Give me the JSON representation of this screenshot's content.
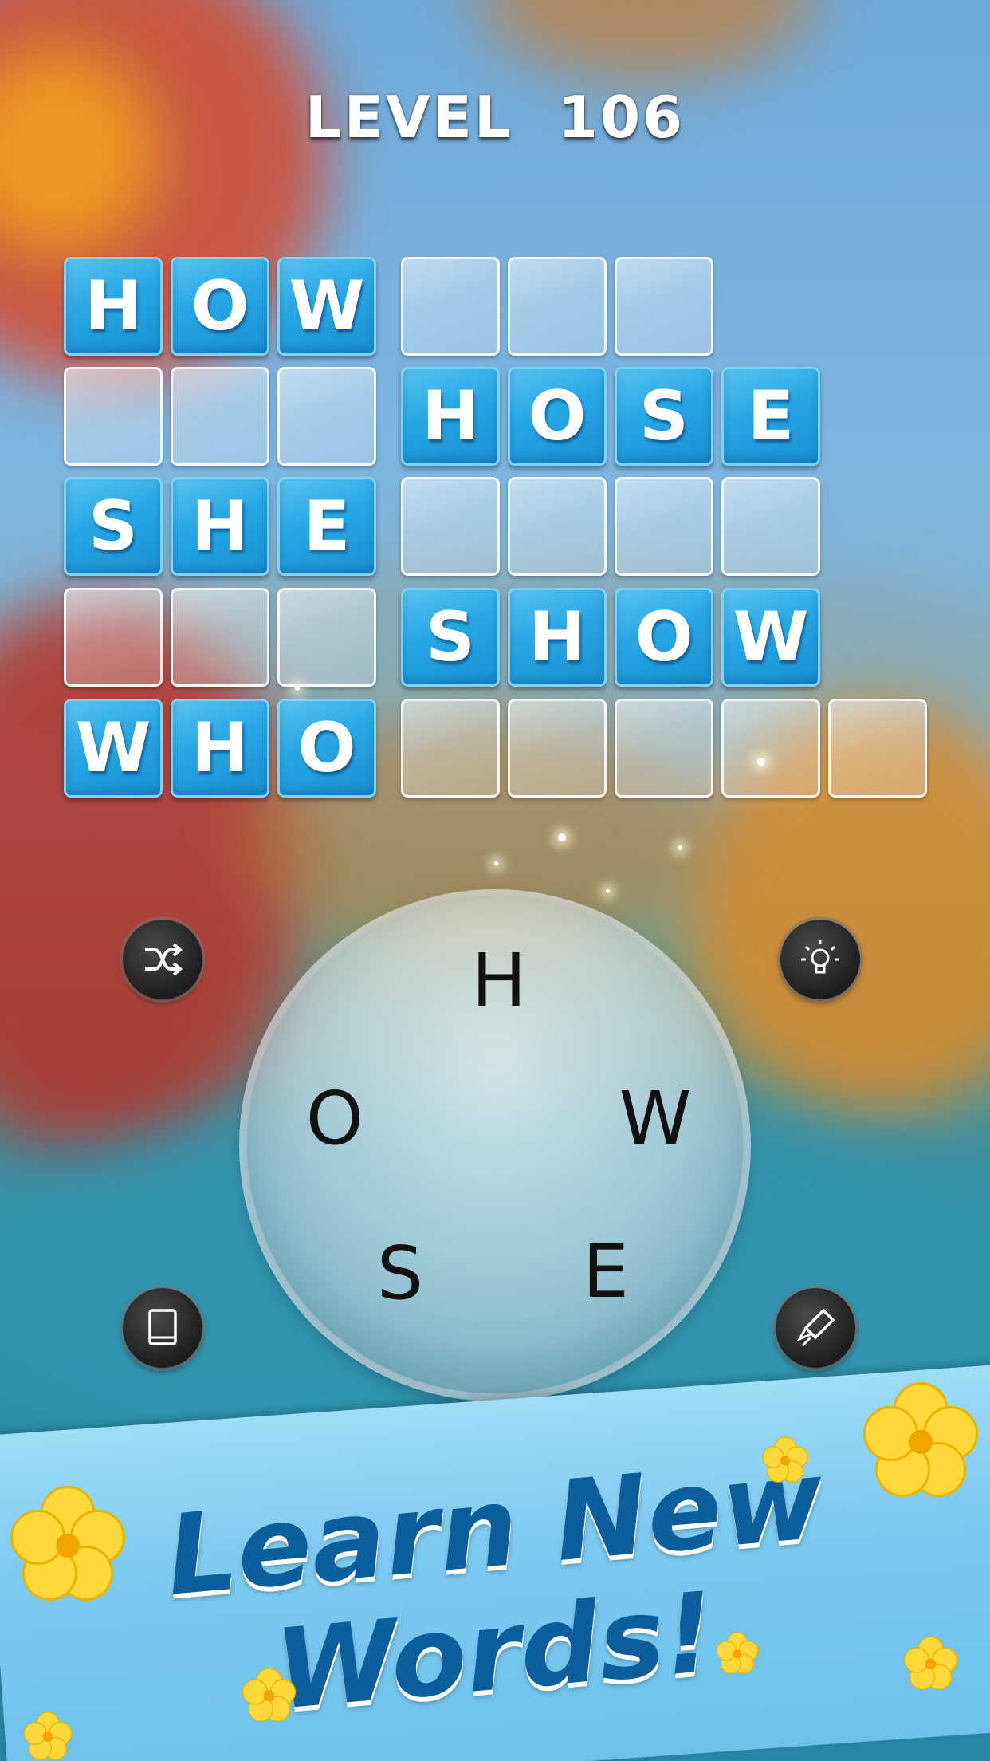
{
  "level_title": "LEVEL  106",
  "grid": {
    "columns": [
      {
        "words": [
          {
            "letters": [
              "H",
              "O",
              "W"
            ],
            "solved": true
          },
          {
            "letters": [
              "",
              "",
              ""
            ],
            "solved": false
          },
          {
            "letters": [
              "S",
              "H",
              "E"
            ],
            "solved": true
          },
          {
            "letters": [
              "",
              "",
              ""
            ],
            "solved": false
          },
          {
            "letters": [
              "W",
              "H",
              "O"
            ],
            "solved": true
          }
        ]
      },
      {
        "words": [
          {
            "letters": [
              "",
              "",
              ""
            ],
            "solved": false
          },
          {
            "letters": [
              "H",
              "O",
              "S",
              "E"
            ],
            "solved": true
          },
          {
            "letters": [
              "",
              "",
              "",
              ""
            ],
            "solved": false
          },
          {
            "letters": [
              "S",
              "H",
              "O",
              "W"
            ],
            "solved": true
          },
          {
            "letters": [
              "",
              "",
              "",
              "",
              ""
            ],
            "solved": false
          }
        ]
      }
    ]
  },
  "wheel": {
    "letters": [
      "H",
      "W",
      "E",
      "S",
      "O"
    ]
  },
  "buttons": {
    "shuffle": "shuffle-icon",
    "hint": "lightbulb-icon",
    "dictionary": "book-icon",
    "rocket": "rocket-icon"
  },
  "banner": {
    "line1": "Learn New",
    "line2": "Words!"
  },
  "colors": {
    "tile_solved": "#27a6e4",
    "banner_text": "#0c5d9c",
    "banner_bg": "#7ccaf0"
  }
}
